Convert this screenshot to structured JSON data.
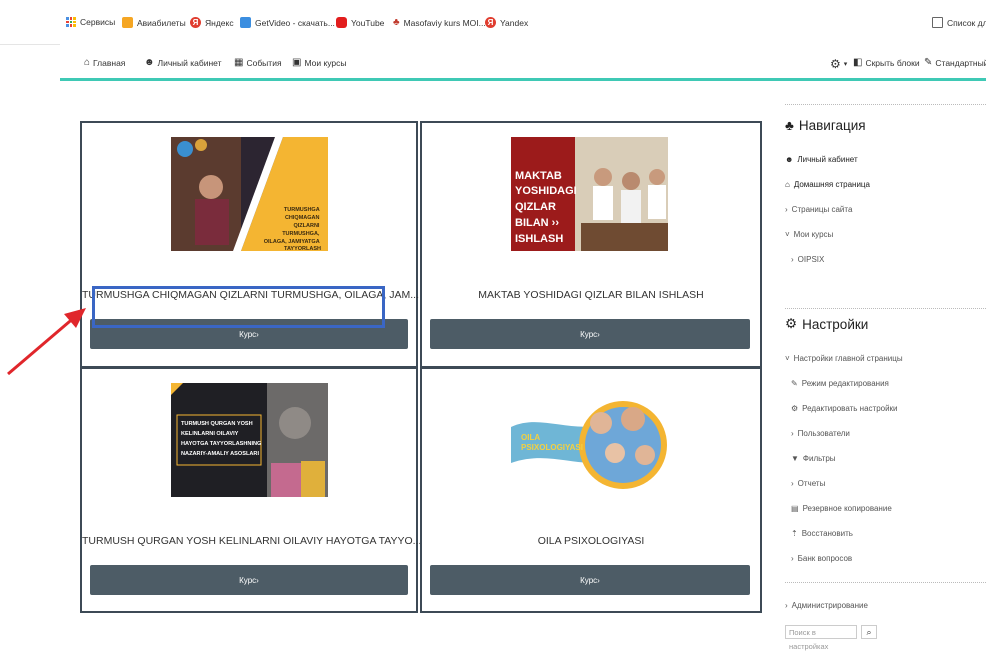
{
  "bookmarks": [
    {
      "label": "Сервисы",
      "icon": "apps-grid-icon"
    },
    {
      "label": "Авиабилеты",
      "icon": "plane-ticket-icon"
    },
    {
      "label": "Яндекс",
      "icon": "yandex-icon"
    },
    {
      "label": "GetVideo - скачать...",
      "icon": "getvideo-icon"
    },
    {
      "label": "YouTube",
      "icon": "youtube-icon"
    },
    {
      "label": "Masofaviy kurs MOI...",
      "icon": "graduation-cap-icon"
    },
    {
      "label": "Yandex",
      "icon": "yandex-icon"
    },
    {
      "label": "Список для",
      "icon": "reading-list-icon"
    }
  ],
  "navbar": {
    "items": [
      {
        "label": "Главная",
        "icon": "home-icon"
      },
      {
        "label": "Личный кабинет",
        "icon": "dashboard-icon"
      },
      {
        "label": "События",
        "icon": "calendar-icon"
      },
      {
        "label": "Мои курсы",
        "icon": "briefcase-icon"
      }
    ],
    "right": [
      {
        "label": "",
        "icon": "gear-icon"
      },
      {
        "label": "Скрыть блоки",
        "icon": "expand-icon"
      },
      {
        "label": "Стандартный в",
        "icon": "wrench-icon"
      }
    ]
  },
  "courses": [
    {
      "title": "TURMUSHGA CHIQMAGAN QIZLARNI TURMUSHGA, OILAGA, JAM...",
      "button": "Курс",
      "image_text": "TURMUSHGA CHIQMAGAN QIZLARNI TURMUSHGA, OILAGA, JAMIYATGA TAYYORLASH"
    },
    {
      "title": "MAKTAB YOSHIDAGI QIZLAR BILAN ISHLASH",
      "button": "Курс",
      "image_text": "MAKTAB YOSHIDAGI QIZLAR BILAN ISHLASH"
    },
    {
      "title": "TURMUSH QURGAN YOSH KELINLARNI OILAVIY HAYOTGA TAYYO...",
      "button": "Курс",
      "image_text": "TURMUSH QURGAN YOSH KELINLARNI OILAVIY HAYOTGA TAYYORLASHNING NAZARIY-AMALIY ASOSLARI"
    },
    {
      "title": "OILA PSIXOLOGIYASI",
      "button": "Курс",
      "image_text": "OILA PSIXOLOGIYASI"
    }
  ],
  "sidebar": {
    "navigation": {
      "title": "Навигация",
      "items": [
        {
          "label": "Личный кабинет"
        },
        {
          "label": "Домашняя страница"
        },
        {
          "label": "Страницы сайта"
        },
        {
          "label": "Мои курсы"
        },
        {
          "label": "OIPSIX"
        }
      ]
    },
    "settings": {
      "title": "Настройки",
      "items": [
        {
          "label": "Настройки главной страницы"
        },
        {
          "label": "Режим редактирования"
        },
        {
          "label": "Редактировать настройки"
        },
        {
          "label": "Пользователи"
        },
        {
          "label": "Фильтры"
        },
        {
          "label": "Отчеты"
        },
        {
          "label": "Резервное копирование"
        },
        {
          "label": "Восстановить"
        },
        {
          "label": "Банк вопросов"
        }
      ]
    },
    "admin": {
      "label": "Администрирование"
    },
    "search": {
      "placeholder": "Поиск в настройках",
      "icon": "search-icon"
    }
  },
  "colors": {
    "accent": "#3fc9b5",
    "button": "#4d5c66",
    "annotation_box": "#3a66c4",
    "annotation_arrow": "#e0262b"
  }
}
